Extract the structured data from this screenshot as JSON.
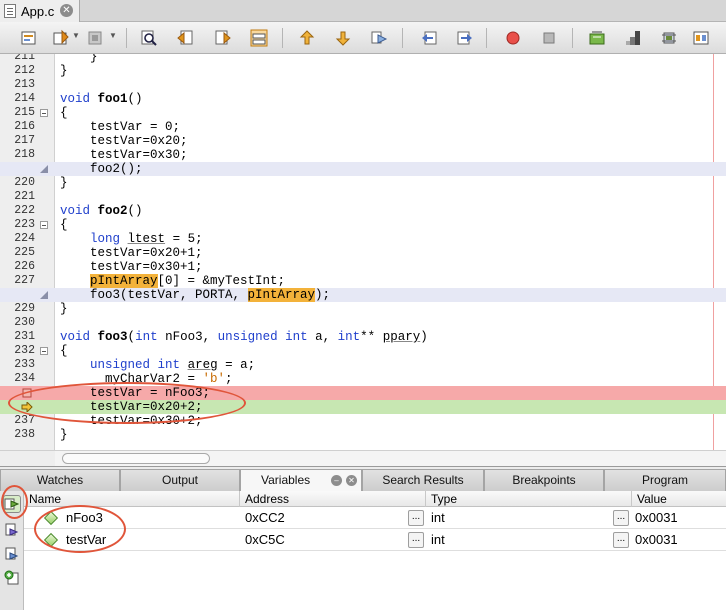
{
  "tab": {
    "file_name": "App.c"
  },
  "toolbar": {
    "icons": [
      "project-icon",
      "debug-dropdown-icon",
      "program-device-icon",
      "find-icon",
      "prev-icon",
      "next-icon",
      "window-icon",
      "step-out-icon",
      "step-into-icon",
      "step-over-icon",
      "back-icon",
      "forward-icon",
      "record-icon",
      "stop-icon",
      "memory-icon",
      "bars-icon",
      "chip-icon"
    ]
  },
  "editor": {
    "lines": [
      {
        "n": "211",
        "code": "    }"
      },
      {
        "n": "212",
        "code": "}"
      },
      {
        "n": "213",
        "code": ""
      },
      {
        "n": "214",
        "code": "void foo1()"
      },
      {
        "n": "215",
        "code": "{"
      },
      {
        "n": "216",
        "code": "    testVar = 0;"
      },
      {
        "n": "217",
        "code": "    testVar=0x20;"
      },
      {
        "n": "218",
        "code": "    testVar=0x30;"
      },
      {
        "n": "",
        "code": "    foo2();"
      },
      {
        "n": "220",
        "code": "}"
      },
      {
        "n": "221",
        "code": ""
      },
      {
        "n": "222",
        "code": "void foo2()"
      },
      {
        "n": "223",
        "code": "{"
      },
      {
        "n": "224",
        "code": "    long ltest = 5;"
      },
      {
        "n": "225",
        "code": "    testVar=0x20+1;"
      },
      {
        "n": "226",
        "code": "    testVar=0x30+1;"
      },
      {
        "n": "227",
        "code": "    pIntArray[0] = &myTestInt;"
      },
      {
        "n": "",
        "code": "    foo3(testVar, PORTA, pIntArray);"
      },
      {
        "n": "229",
        "code": "}"
      },
      {
        "n": "230",
        "code": ""
      },
      {
        "n": "231",
        "code": "void foo3(int nFoo3, unsigned int a, int** ppary)"
      },
      {
        "n": "232",
        "code": "{"
      },
      {
        "n": "233",
        "code": "    unsigned int areg = a;"
      },
      {
        "n": "234",
        "code": "    __myCharVar2 = 'b';"
      },
      {
        "n": "",
        "code": "    testVar = nFoo3;"
      },
      {
        "n": "",
        "code": "    testVar=0x20+2;"
      },
      {
        "n": "237",
        "code": "    testVar=0x30+2;"
      },
      {
        "n": "238",
        "code": "}"
      }
    ]
  },
  "panel": {
    "tabs": [
      "Watches",
      "Output",
      "Variables",
      "Search Results",
      "Breakpoints",
      "Program"
    ],
    "active_tab": "Variables",
    "columns": {
      "name": "Name",
      "address": "Address",
      "type": "Type",
      "value": "Value"
    },
    "rows": [
      {
        "name": "nFoo3",
        "address": "0xCC2",
        "type": "int",
        "value": "0x0031"
      },
      {
        "name": "testVar",
        "address": "0xC5C",
        "type": "int",
        "value": "0x0031"
      }
    ],
    "ellipsis": "..."
  },
  "colors": {
    "breakpoint_row": "#f6a9a9",
    "pc_row": "#c7e7b2",
    "current_row": "#e6e8f5",
    "keyword": "#1f3fcc",
    "annotation": "#e0553a"
  }
}
